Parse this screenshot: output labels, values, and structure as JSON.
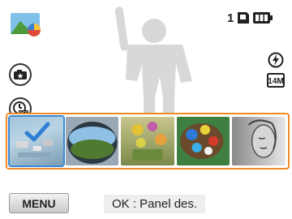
{
  "status": {
    "shot_count": "1",
    "icons": [
      "scene-thumbnail-icon",
      "memory-card-icon",
      "battery-icon",
      "flash-auto-icon",
      "resolution-14m-icon",
      "smart-filter-icon",
      "timer-off-icon"
    ],
    "resolution_label": "14M"
  },
  "filters": {
    "tiles": [
      "filter-miniature",
      "filter-fisheye",
      "filter-oil-painting",
      "filter-palette",
      "filter-sketch"
    ],
    "selected_index": 0,
    "accent_color": "#f08a24",
    "selection_color": "#3c8ad8"
  },
  "bottom": {
    "menu_label": "MENU",
    "ok_hint": "OK : Panel des."
  }
}
